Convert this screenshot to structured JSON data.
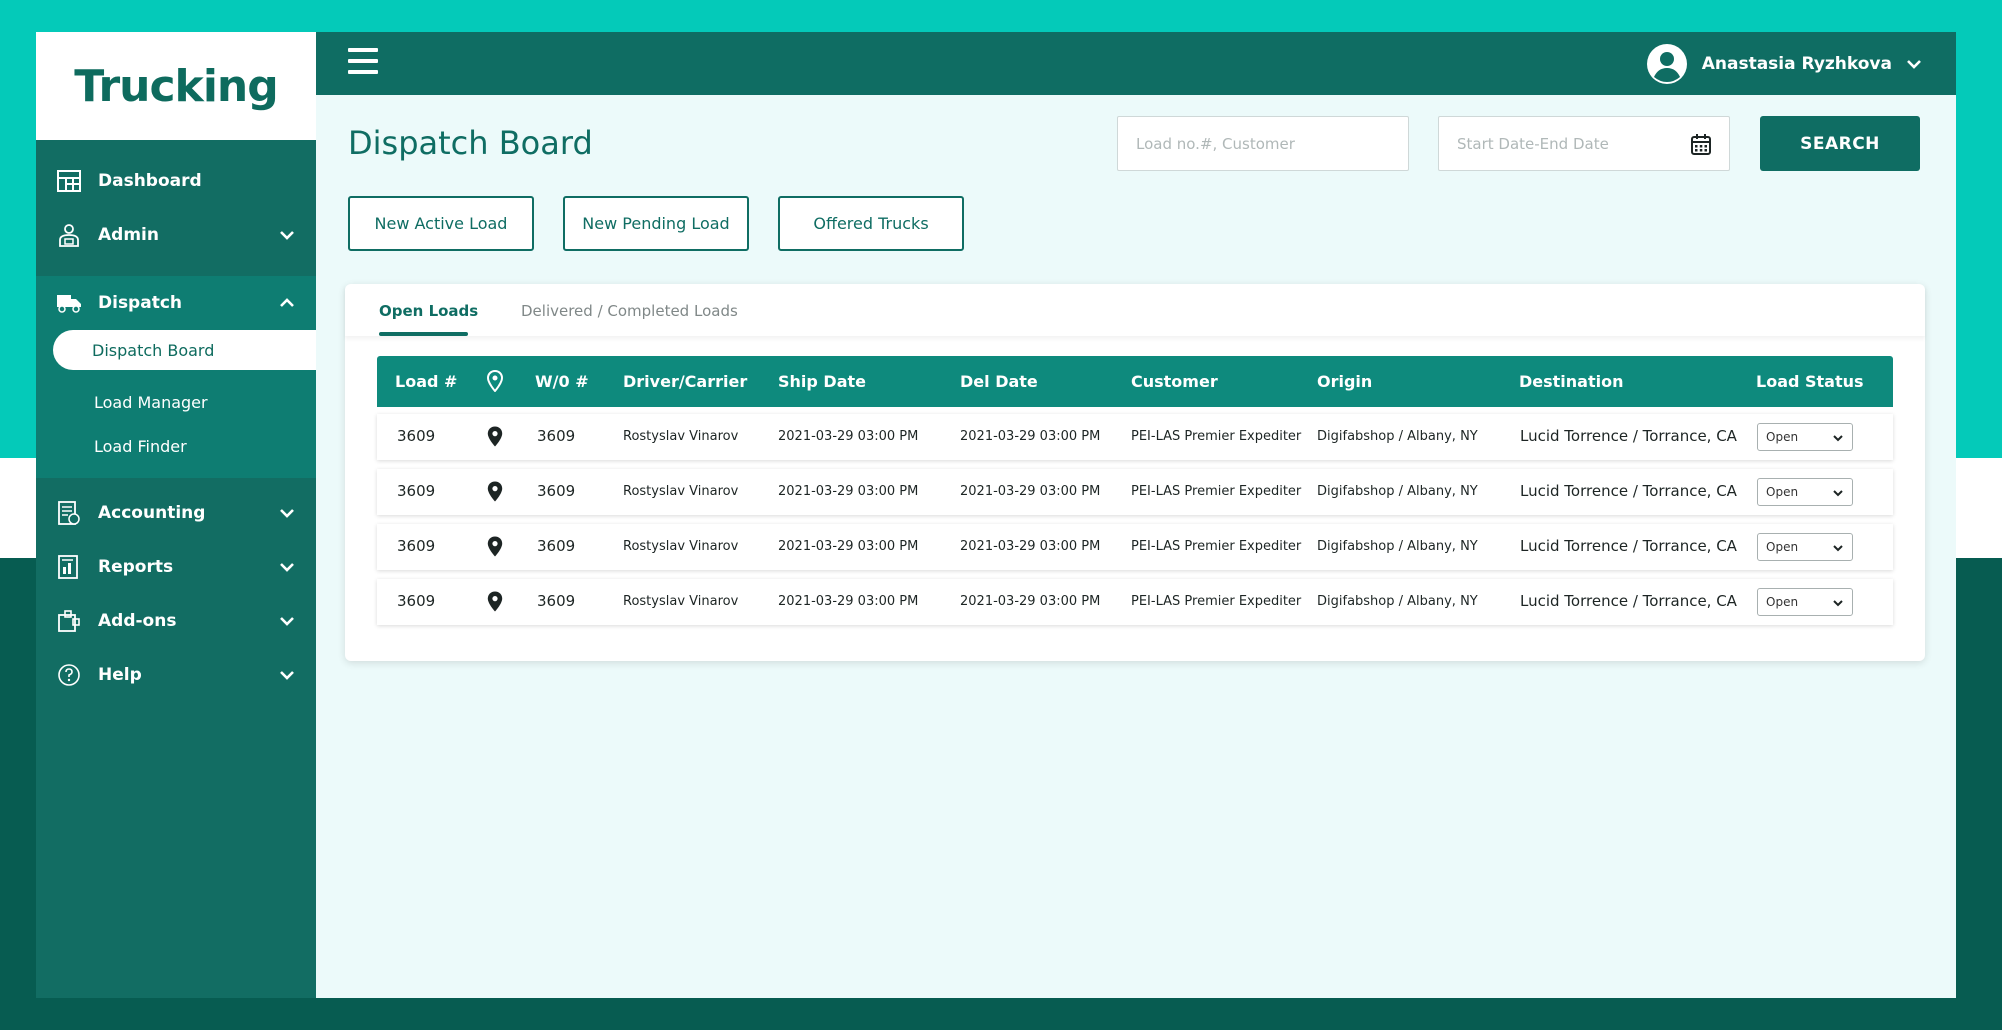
{
  "brand": {
    "logo_text": "Trucking"
  },
  "sidebar": {
    "items": [
      {
        "label": "Dashboard",
        "icon": "dashboard-icon"
      },
      {
        "label": "Admin",
        "icon": "admin-icon",
        "chevron": "down"
      },
      {
        "label": "Dispatch",
        "icon": "truck-icon",
        "chevron": "up",
        "expanded": true,
        "children": [
          {
            "label": "Dispatch Board",
            "active": true
          },
          {
            "label": "Load Manager"
          },
          {
            "label": "Load Finder"
          }
        ]
      },
      {
        "label": "Accounting",
        "icon": "accounting-icon",
        "chevron": "down"
      },
      {
        "label": "Reports",
        "icon": "reports-icon",
        "chevron": "down"
      },
      {
        "label": "Add-ons",
        "icon": "addons-icon",
        "chevron": "down"
      },
      {
        "label": "Help",
        "icon": "help-icon",
        "chevron": "down"
      }
    ]
  },
  "header": {
    "user_name": "Anastasia Ryzhkova",
    "user_icon": "user-avatar-icon"
  },
  "page": {
    "title": "Dispatch Board",
    "search_placeholder": "Load no.#, Customer",
    "date_placeholder": "Start Date-End Date",
    "search_button": "SEARCH",
    "actions": [
      "New Active Load",
      "New Pending Load",
      "Offered Trucks"
    ]
  },
  "tabs": [
    {
      "label": "Open Loads",
      "active": true
    },
    {
      "label": "Delivered / Completed Loads",
      "active": false
    }
  ],
  "table": {
    "columns": [
      "Load #",
      "",
      "W/0 #",
      "Driver/Carrier",
      "Ship Date",
      "Del Date",
      "Customer",
      "Origin",
      "Destination",
      "Load Status"
    ],
    "rows": [
      {
        "load": "3609",
        "wo": "3609",
        "driver": "Rostyslav Vinarov",
        "ship": "2021-03-29 03:00 PM",
        "del": "2021-03-29 03:00 PM",
        "customer": "PEI-LAS Premier Expediter",
        "origin": "Digifabshop / Albany, NY",
        "destination": "Lucid Torrence / Torrance, CA",
        "status": "Open"
      },
      {
        "load": "3609",
        "wo": "3609",
        "driver": "Rostyslav Vinarov",
        "ship": "2021-03-29 03:00 PM",
        "del": "2021-03-29 03:00 PM",
        "customer": "PEI-LAS Premier Expediter",
        "origin": "Digifabshop / Albany, NY",
        "destination": "Lucid Torrence / Torrance, CA",
        "status": "Open"
      },
      {
        "load": "3609",
        "wo": "3609",
        "driver": "Rostyslav Vinarov",
        "ship": "2021-03-29 03:00 PM",
        "del": "2021-03-29 03:00 PM",
        "customer": "PEI-LAS Premier Expediter",
        "origin": "Digifabshop / Albany, NY",
        "destination": "Lucid Torrence / Torrance, CA",
        "status": "Open"
      },
      {
        "load": "3609",
        "wo": "3609",
        "driver": "Rostyslav Vinarov",
        "ship": "2021-03-29 03:00 PM",
        "del": "2021-03-29 03:00 PM",
        "customer": "PEI-LAS Premier Expediter",
        "origin": "Digifabshop / Albany, NY",
        "destination": "Lucid Torrence / Torrance, CA",
        "status": "Open"
      }
    ]
  },
  "colors": {
    "primary": "#0f6d63",
    "sidebar": "#126d63",
    "sidebar_group": "#0e7d72",
    "table_header": "#0e8a7d",
    "accent_bg": "#04cab9",
    "main_bg": "#ecfafa"
  }
}
